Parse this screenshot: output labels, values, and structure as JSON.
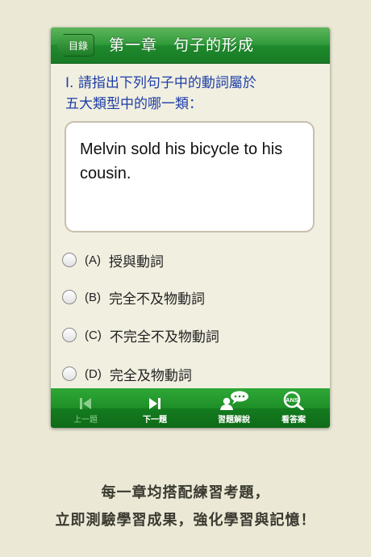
{
  "navbar": {
    "back_label": "目錄",
    "title": "第一章　句子的形成"
  },
  "question": {
    "prompt_line1": "I. 請指出下列句子中的動詞屬於",
    "prompt_line2": "五大類型中的哪一類：",
    "sentence": "Melvin sold his bicycle to his cousin."
  },
  "options": [
    {
      "letter": "(A)",
      "text": "授與動詞"
    },
    {
      "letter": "(B)",
      "text": "完全不及物動詞"
    },
    {
      "letter": "(C)",
      "text": "不完全不及物動詞"
    },
    {
      "letter": "(D)",
      "text": "完全及物動詞"
    }
  ],
  "tabbar": {
    "prev_label": "上一題",
    "next_label": "下一題",
    "explain_label": "習題解說",
    "answer_label": "看答案",
    "answer_icon_text": "ANS"
  },
  "caption": {
    "line1": "每一章均搭配練習考題，",
    "line2": "立即測驗學習成果，強化學習與記憶！"
  },
  "colors": {
    "nav_green": "#2f9a3a",
    "question_blue": "#1d3ea8",
    "background": "#ebe9d6"
  }
}
